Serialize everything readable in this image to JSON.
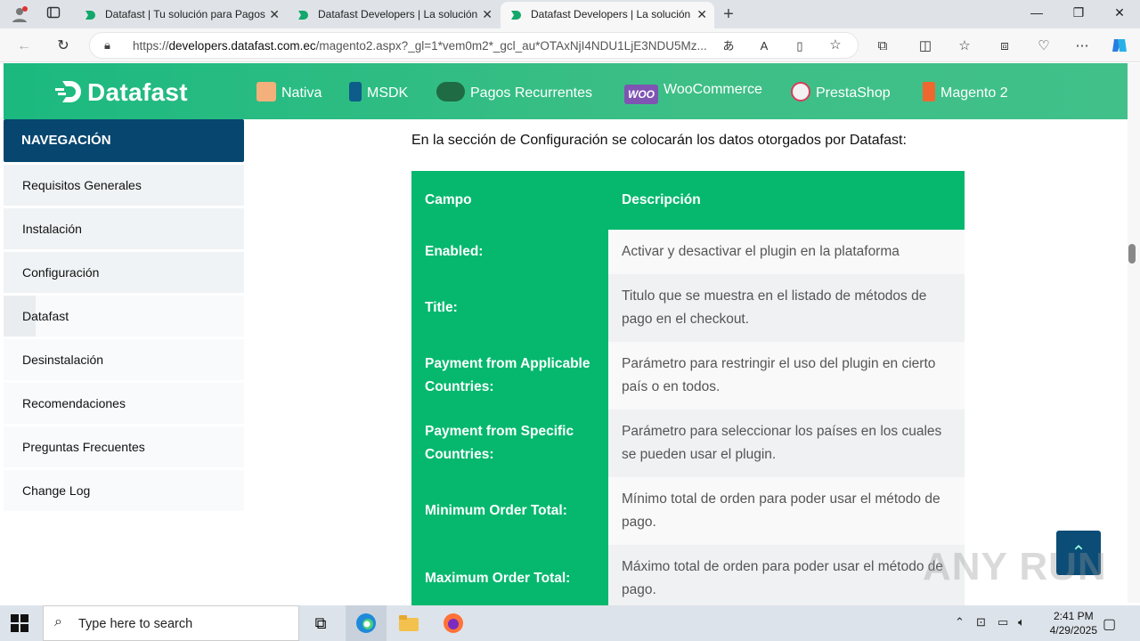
{
  "browser": {
    "tabs": [
      {
        "label": "Datafast | Tu solución para Pagos"
      },
      {
        "label": "Datafast Developers | La solución"
      },
      {
        "label": "Datafast Developers | La solución"
      }
    ],
    "url_prefix": "https://",
    "url_domain": "developers.datafast.com.ec",
    "url_rest": "/magento2.aspx?_gl=1*vem0m2*_gcl_au*OTAxNjI4NDU1LjE3NDU5Mz..."
  },
  "site": {
    "logo": "Datafast",
    "nav": [
      {
        "label": "Nativa"
      },
      {
        "label": "MSDK"
      },
      {
        "label": "Pagos Recurrentes"
      },
      {
        "label": "WooCommerce"
      },
      {
        "label": "PrestaShop"
      },
      {
        "label": "Magento 2"
      }
    ],
    "woo_badge": "WOO"
  },
  "sidebar": {
    "title": "NAVEGACIÓN",
    "items": [
      {
        "label": "Requisitos Generales"
      },
      {
        "label": "Instalación"
      },
      {
        "label": "Configuración"
      },
      {
        "label": "Datafast"
      },
      {
        "label": "Desinstalación"
      },
      {
        "label": "Recomendaciones"
      },
      {
        "label": "Preguntas Frecuentes"
      },
      {
        "label": "Change Log"
      }
    ]
  },
  "content": {
    "intro": "En la sección de Configuración se colocarán los datos otorgados por Datafast:",
    "table": {
      "headers": [
        "Campo",
        "Descripción"
      ],
      "rows": [
        {
          "field": "Enabled:",
          "description": "Activar y desactivar el plugin en la plataforma"
        },
        {
          "field": "Title:",
          "description": "Titulo que se muestra en el listado de métodos de pago en el checkout."
        },
        {
          "field": "Payment from Applicable Countries:",
          "description": "Parámetro para restringir el uso del plugin en cierto país o en todos."
        },
        {
          "field": "Payment from Specific Countries:",
          "description": "Parámetro para seleccionar los países en los cuales se pueden usar el plugin."
        },
        {
          "field": "Minimum Order Total:",
          "description": "Mínimo total de orden para poder usar el método de pago."
        },
        {
          "field": "Maximum Order Total:",
          "description": "Máximo total de orden para poder usar el método de pago."
        }
      ]
    }
  },
  "watermark": "ANY RUN",
  "taskbar": {
    "search_placeholder": "Type here to search",
    "time": "2:41 PM",
    "date": "4/29/2025"
  }
}
